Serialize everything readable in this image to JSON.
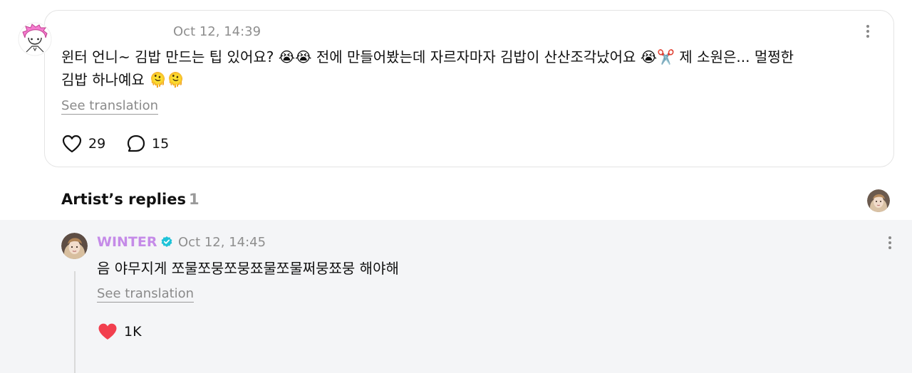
{
  "post": {
    "time": "Oct 12, 14:39",
    "text_line1": "윈터 언니~ 김밥 만드는 팁 있어요? 😭😭 전에 만들어봤는데 자르자마자 김밥이 산산조각났어요 😭✂️ 제 소원은... 멀쩡한",
    "text_line2": "김밥 하나예요 🫠🫠",
    "see_translation": "See translation",
    "likes": "29",
    "comments": "15"
  },
  "replies_section": {
    "title": "Artist’s replies",
    "count": "1"
  },
  "reply": {
    "author": "WINTER",
    "verified": true,
    "time": "Oct 12, 14:45",
    "text": "음 야무지게 쪼물쪼뭉쪼뭉쬬물쪼물쩌뭉쬬뭉 해야해",
    "see_translation": "See translation",
    "likes": "1K"
  },
  "colors": {
    "artist_name": "#c58be8",
    "verified_badge": "#1ec3d8",
    "liked_heart": "#f23f4e",
    "reply_background": "#f4f5f7"
  },
  "icons": {
    "post_like": "heart-outline-icon",
    "post_comment": "speech-bubble-icon",
    "reply_like": "heart-filled-icon",
    "more": "vertical-dots-icon"
  }
}
